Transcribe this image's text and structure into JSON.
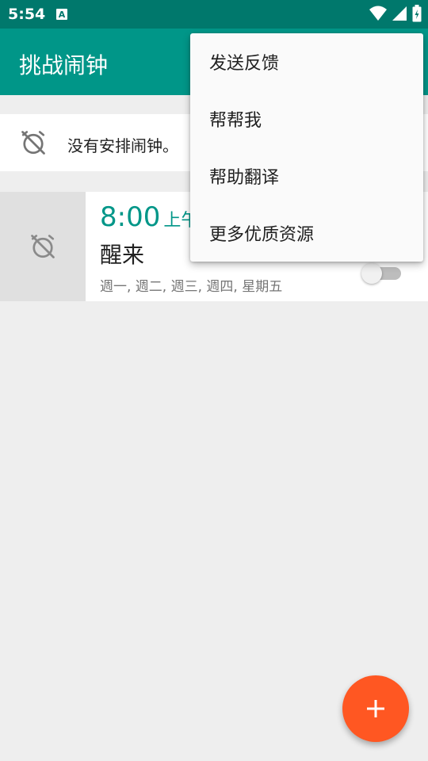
{
  "status_bar": {
    "time": "5:54",
    "notification_glyph": "A",
    "icons": [
      "wifi-icon",
      "signal-icon",
      "battery-icon"
    ]
  },
  "app_bar": {
    "title": "挑战闹钟",
    "color": "#009688"
  },
  "no_alarm_card": {
    "text": "没有安排闹钟。",
    "icon": "alarm-off-icon"
  },
  "alarm": {
    "time": "8:00",
    "ampm": "上午",
    "label": "醒来",
    "days": "週一, 週二, 週三, 週四, 星期五",
    "enabled": false,
    "icon": "alarm-off-icon"
  },
  "menu": {
    "items": [
      {
        "label": "发送反馈"
      },
      {
        "label": "帮帮我"
      },
      {
        "label": "帮助翻译"
      },
      {
        "label": "更多优质资源"
      }
    ]
  },
  "fab": {
    "icon": "plus-icon",
    "color": "#ff5722"
  }
}
